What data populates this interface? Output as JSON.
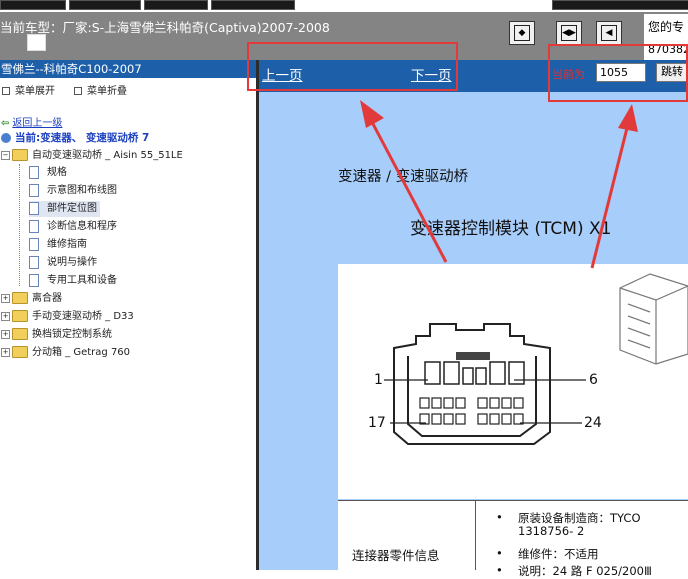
{
  "header": {
    "vehicle_label": "当前车型：",
    "vehicle_value": "厂家:S-上海雪佛兰科帕奇(Captiva)2007-2008",
    "user_line1": "您的专",
    "user_line2": "870382",
    "nav_buttons": [
      "first-page",
      "prev-next",
      "last-page"
    ]
  },
  "left": {
    "title": "雪佛兰--科帕奇C100-2007",
    "expand_menu": "菜单展开",
    "collapse_menu": "菜单折叠",
    "back_link": "返回上一级",
    "current_path": "当前:变速器、 变速驱动桥 7",
    "tree": {
      "auto_trans": "自动变速驱动桥 _ Aisin 55_51LE",
      "children": [
        "规格",
        "示意图和布线图",
        "部件定位图",
        "诊断信息和程序",
        "维修指南",
        "说明与操作",
        "专用工具和设备"
      ],
      "selected_index": 2,
      "others": [
        "离合器",
        "手动变速驱动桥 _ D33",
        "换档锁定控制系统",
        "分动箱 _ Getrag 760"
      ]
    }
  },
  "right": {
    "prev_page": "上一页",
    "next_page": "下一页",
    "current_label": "当前为",
    "page_value": "1055",
    "jump_button": "跳转",
    "section_title": "变速器 / 变速驱动桥",
    "doc_title": "变速器控制模块 (TCM) X1",
    "pin_labels": [
      "1",
      "6",
      "17",
      "24"
    ],
    "info_label": "连接器零件信息",
    "info_items": [
      "原装设备制造商：TYCO",
      "1318756- 2",
      "维修件：不适用",
      "说明：24 路 F 025/200Ⅲ"
    ]
  },
  "colors": {
    "header_gray": "#848484",
    "nav_blue": "#1d5fa8",
    "content_blue": "#a7cdfb",
    "annotation_red": "#e23a3a"
  }
}
